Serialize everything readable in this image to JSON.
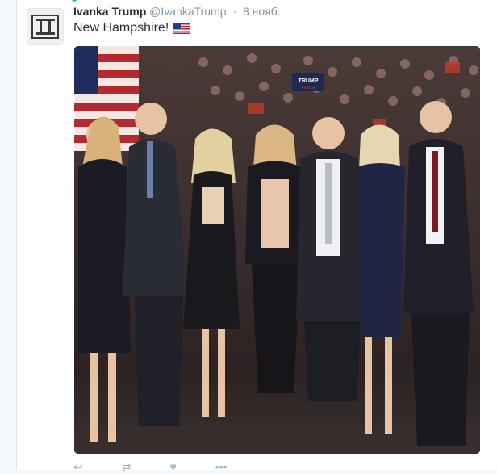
{
  "tweet": {
    "author_name": "Ivanka Trump",
    "author_handle": "@IvankaTrump",
    "separator": "·",
    "timestamp": "8 нояб.",
    "text": "New Hampshire!",
    "emoji_icon": "us-flag-icon"
  },
  "media": {
    "icon": "group-photo",
    "sign_text": "TRUMP",
    "sign_subtext": "PENCE"
  },
  "actions": {
    "reply_icon": "reply-icon",
    "retweet_icon": "retweet-icon",
    "like_icon": "heart-icon",
    "more_icon": "more-icon"
  }
}
